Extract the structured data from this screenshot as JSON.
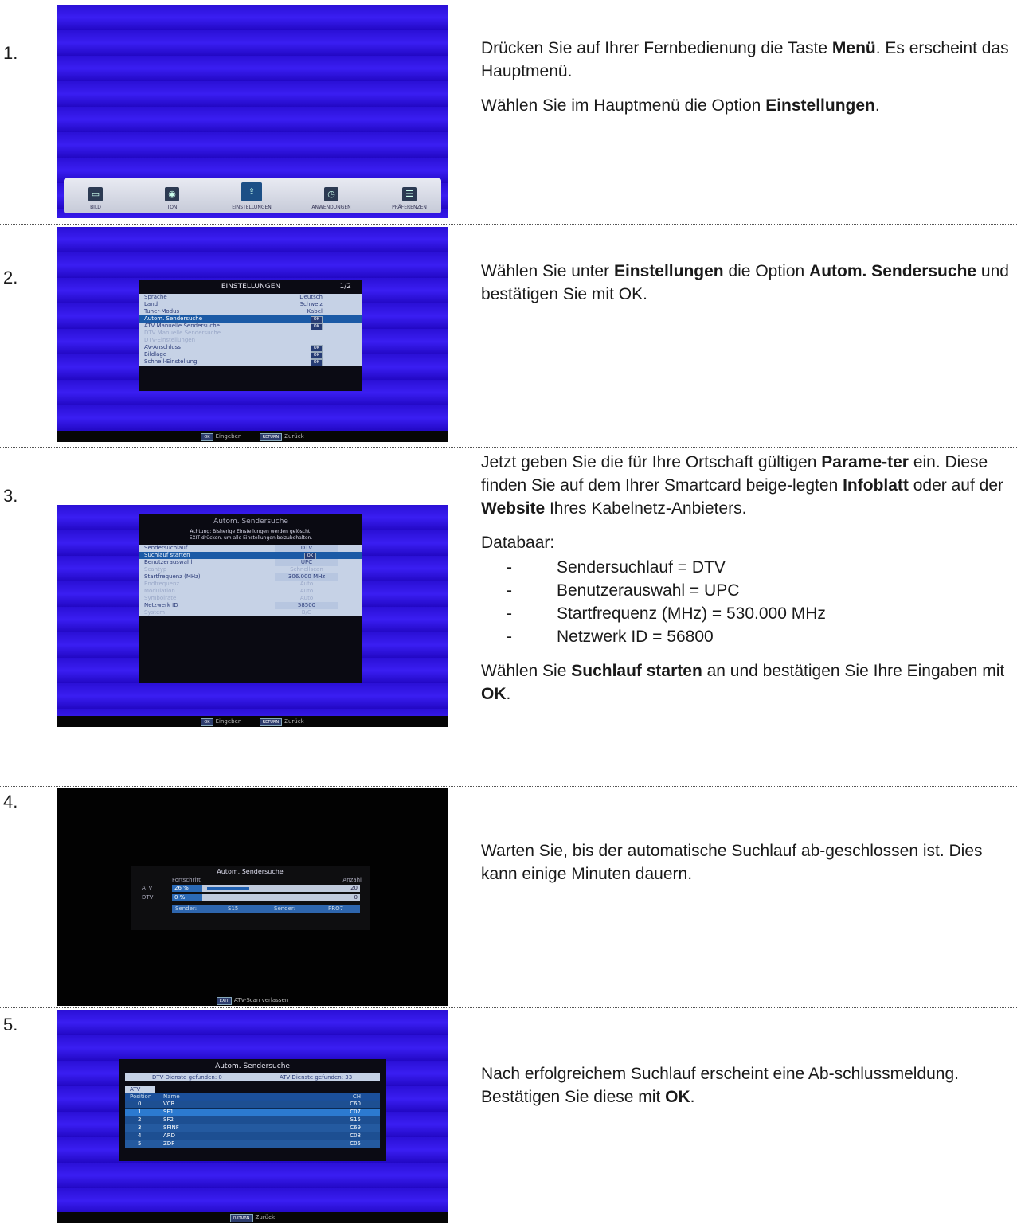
{
  "steps": [
    {
      "number": "1.",
      "paragraphs": [
        {
          "parts": [
            {
              "t": "Drücken Sie auf Ihrer Fernbedienung die Taste "
            },
            {
              "t": "Menü",
              "b": true
            },
            {
              "t": ". Es erscheint das Hauptmenü."
            }
          ]
        },
        {
          "parts": [
            {
              "t": "Wählen Sie im Hauptmenü die Option "
            },
            {
              "t": "Einstellungen",
              "b": true
            },
            {
              "t": "."
            }
          ]
        }
      ]
    },
    {
      "number": "2.",
      "paragraphs": [
        {
          "parts": [
            {
              "t": "Wählen Sie unter "
            },
            {
              "t": "Einstellungen",
              "b": true
            },
            {
              "t": " die Option "
            },
            {
              "t": "Autom. Sendersuche",
              "b": true
            },
            {
              "t": " und bestätigen Sie mit OK."
            }
          ]
        }
      ]
    },
    {
      "number": "3.",
      "paragraphs": [
        {
          "parts": [
            {
              "t": "Jetzt geben Sie die für Ihre Ortschaft gültigen "
            },
            {
              "t": "Parame-ter",
              "b": true
            },
            {
              "t": " ein. Diese finden Sie auf dem Ihrer Smartcard beige-legten "
            },
            {
              "t": "Infoblatt",
              "b": true
            },
            {
              "t": " oder auf der "
            },
            {
              "t": "Website",
              "b": true
            },
            {
              "t": " Ihres Kabelnetz-Anbieters."
            }
          ]
        },
        {
          "parts": [
            {
              "t": "Databaar:"
            }
          ]
        }
      ],
      "list": [
        "Sendersuchlauf = DTV",
        "Benutzerauswahl = UPC",
        "Startfrequenz (MHz) = 530.000 MHz",
        "Netzwerk ID = 56800"
      ],
      "after": [
        {
          "parts": [
            {
              "t": "Wählen Sie "
            },
            {
              "t": "Suchlauf starten",
              "b": true
            },
            {
              "t": " an und bestätigen Sie Ihre Eingaben mit "
            },
            {
              "t": "OK",
              "b": true
            },
            {
              "t": "."
            }
          ]
        }
      ]
    },
    {
      "number": "4.",
      "paragraphs": [
        {
          "parts": [
            {
              "t": "Warten Sie, bis der automatische Suchlauf ab-geschlossen ist. Dies kann einige Minuten dauern."
            }
          ]
        }
      ]
    },
    {
      "number": "5.",
      "paragraphs": [
        {
          "parts": [
            {
              "t": "Nach erfolgreichem Suchlauf erscheint eine Ab-schlussmeldung. Bestätigen Sie diese mit "
            },
            {
              "t": "OK",
              "b": true
            },
            {
              "t": "."
            }
          ]
        }
      ]
    }
  ],
  "screen1": {
    "items": [
      "BILD",
      "TON",
      "EINSTELLUNGEN",
      "ANWENDUNGEN",
      "PRÄFERENZEN"
    ],
    "icons": [
      "monitor-icon",
      "speaker-icon",
      "settings-box-icon",
      "timer-icon",
      "list-icon"
    ]
  },
  "screen2": {
    "title": "EINSTELLUNGEN",
    "page": "1/2",
    "rows": [
      {
        "label": "Sprache",
        "value": "Deutsch"
      },
      {
        "label": "Land",
        "value": "Schweiz"
      },
      {
        "label": "Tuner-Modus",
        "value": "Kabel"
      },
      {
        "label": "Autom. Sendersuche",
        "value": "OK"
      },
      {
        "label": "ATV  Manuelle Sendersuche",
        "value": "OK"
      },
      {
        "label": "DTV  Manuelle Sendersuche",
        "value": ""
      },
      {
        "label": "DTV-Einstellungen",
        "value": ""
      },
      {
        "label": "AV-Anschluss",
        "value": "OK"
      },
      {
        "label": "Bildlage",
        "value": "OK"
      },
      {
        "label": "Schnell-Einstellung",
        "value": "OK"
      }
    ],
    "footer_ok": "OK",
    "footer_enter": "Eingeben",
    "footer_return": "RETURN",
    "footer_back": "Zurück"
  },
  "screen3": {
    "title": "Autom. Sendersuche",
    "warning1": "Achtung: Bisherige Einstellungen werden gelöscht!",
    "warning2": "EXIT drücken, um alle Einstellungen beizubehalten.",
    "rows": [
      {
        "label": "Sendersuchlauf",
        "value": "DTV"
      },
      {
        "label": "Suchlauf starten",
        "value": "OK"
      },
      {
        "label": "Benutzerauswahl",
        "value": "UPC"
      },
      {
        "label": "Scantyp",
        "value": "Schnellscan"
      },
      {
        "label": "Startfrequenz (MHz)",
        "value": "306.000 MHz"
      },
      {
        "label": "Endfrequenz",
        "value": "Auto"
      },
      {
        "label": "Modulation",
        "value": "Auto"
      },
      {
        "label": "Symbolrate",
        "value": "Auto"
      },
      {
        "label": "Netzwerk ID",
        "value": "58500"
      },
      {
        "label": "System",
        "value": "B/G"
      }
    ],
    "footer_ok": "OK",
    "footer_enter": "Eingeben",
    "footer_return": "RETURN",
    "footer_back": "Zurück"
  },
  "screen4": {
    "title": "Autom. Sendersuche",
    "progress_label": "Fortschritt",
    "count_label": "Anzahl",
    "atv_label": "ATV",
    "atv_percent": "26 %",
    "atv_fraction": 0.26,
    "atv_count": "20",
    "dtv_label": "DTV",
    "dtv_percent": "0  %",
    "dtv_fraction": 0.0,
    "dtv_count": "0",
    "sender_label1": "Sender:",
    "sender_value1": "S15",
    "sender_label2": "Sender:",
    "sender_value2": "PRO7",
    "footer_exit": "EXIT",
    "footer_text": "ATV-Scan verlassen"
  },
  "screen5": {
    "title": "Autom. Sendersuche",
    "dtv_found": "DTV-Dienste gefunden: 0",
    "atv_found": "ATV-Dienste gefunden: 33",
    "tab": "ATV",
    "col_pos": "Position",
    "col_name": "Name",
    "col_ch": "CH",
    "rows": [
      {
        "pos": "0",
        "name": "VCR",
        "ch": "C60"
      },
      {
        "pos": "1",
        "name": "SF1",
        "ch": "C07"
      },
      {
        "pos": "2",
        "name": "SF2",
        "ch": "S15"
      },
      {
        "pos": "3",
        "name": "SFINF",
        "ch": "C69"
      },
      {
        "pos": "4",
        "name": "ARD",
        "ch": "C08"
      },
      {
        "pos": "5",
        "name": "ZDF",
        "ch": "C05"
      }
    ],
    "footer_return": "RETURN",
    "footer_back": "Zurück"
  }
}
